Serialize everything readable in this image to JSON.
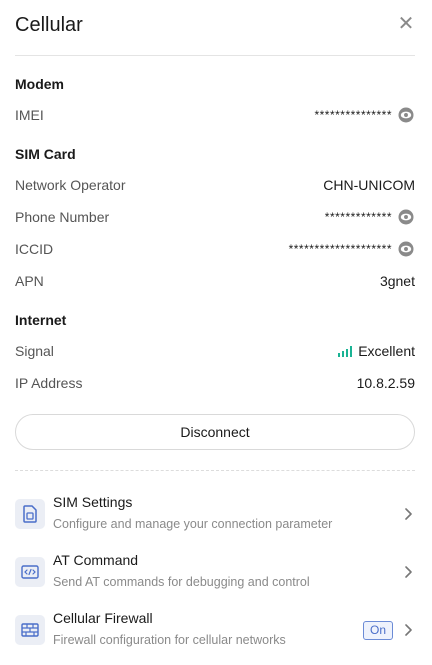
{
  "header": {
    "title": "Cellular"
  },
  "modem": {
    "section_title": "Modem",
    "imei": {
      "label": "IMEI",
      "value": "***************"
    }
  },
  "sim_card": {
    "section_title": "SIM Card",
    "network_operator": {
      "label": "Network Operator",
      "value": "CHN-UNICOM"
    },
    "phone_number": {
      "label": "Phone Number",
      "value": "*************"
    },
    "iccid": {
      "label": "ICCID",
      "value": "********************"
    },
    "apn": {
      "label": "APN",
      "value": "3gnet"
    }
  },
  "internet": {
    "section_title": "Internet",
    "signal": {
      "label": "Signal",
      "value": "Excellent",
      "bars": 4,
      "color": "#1ab394"
    },
    "ip_address": {
      "label": "IP Address",
      "value": "10.8.2.59"
    }
  },
  "actions": {
    "disconnect_label": "Disconnect"
  },
  "menu": [
    {
      "title": "SIM Settings",
      "description": "Configure and manage your connection parameter",
      "icon": "sim-card-icon"
    },
    {
      "title": "AT Command",
      "description": "Send AT commands for debugging and control",
      "icon": "terminal-icon"
    },
    {
      "title": "Cellular Firewall",
      "description": "Firewall configuration for cellular networks",
      "icon": "firewall-icon",
      "badge": "On"
    }
  ],
  "colors": {
    "accent": "#1ab394",
    "icon_tint": "#4a6ec9",
    "badge_border": "#6b8bd6"
  }
}
